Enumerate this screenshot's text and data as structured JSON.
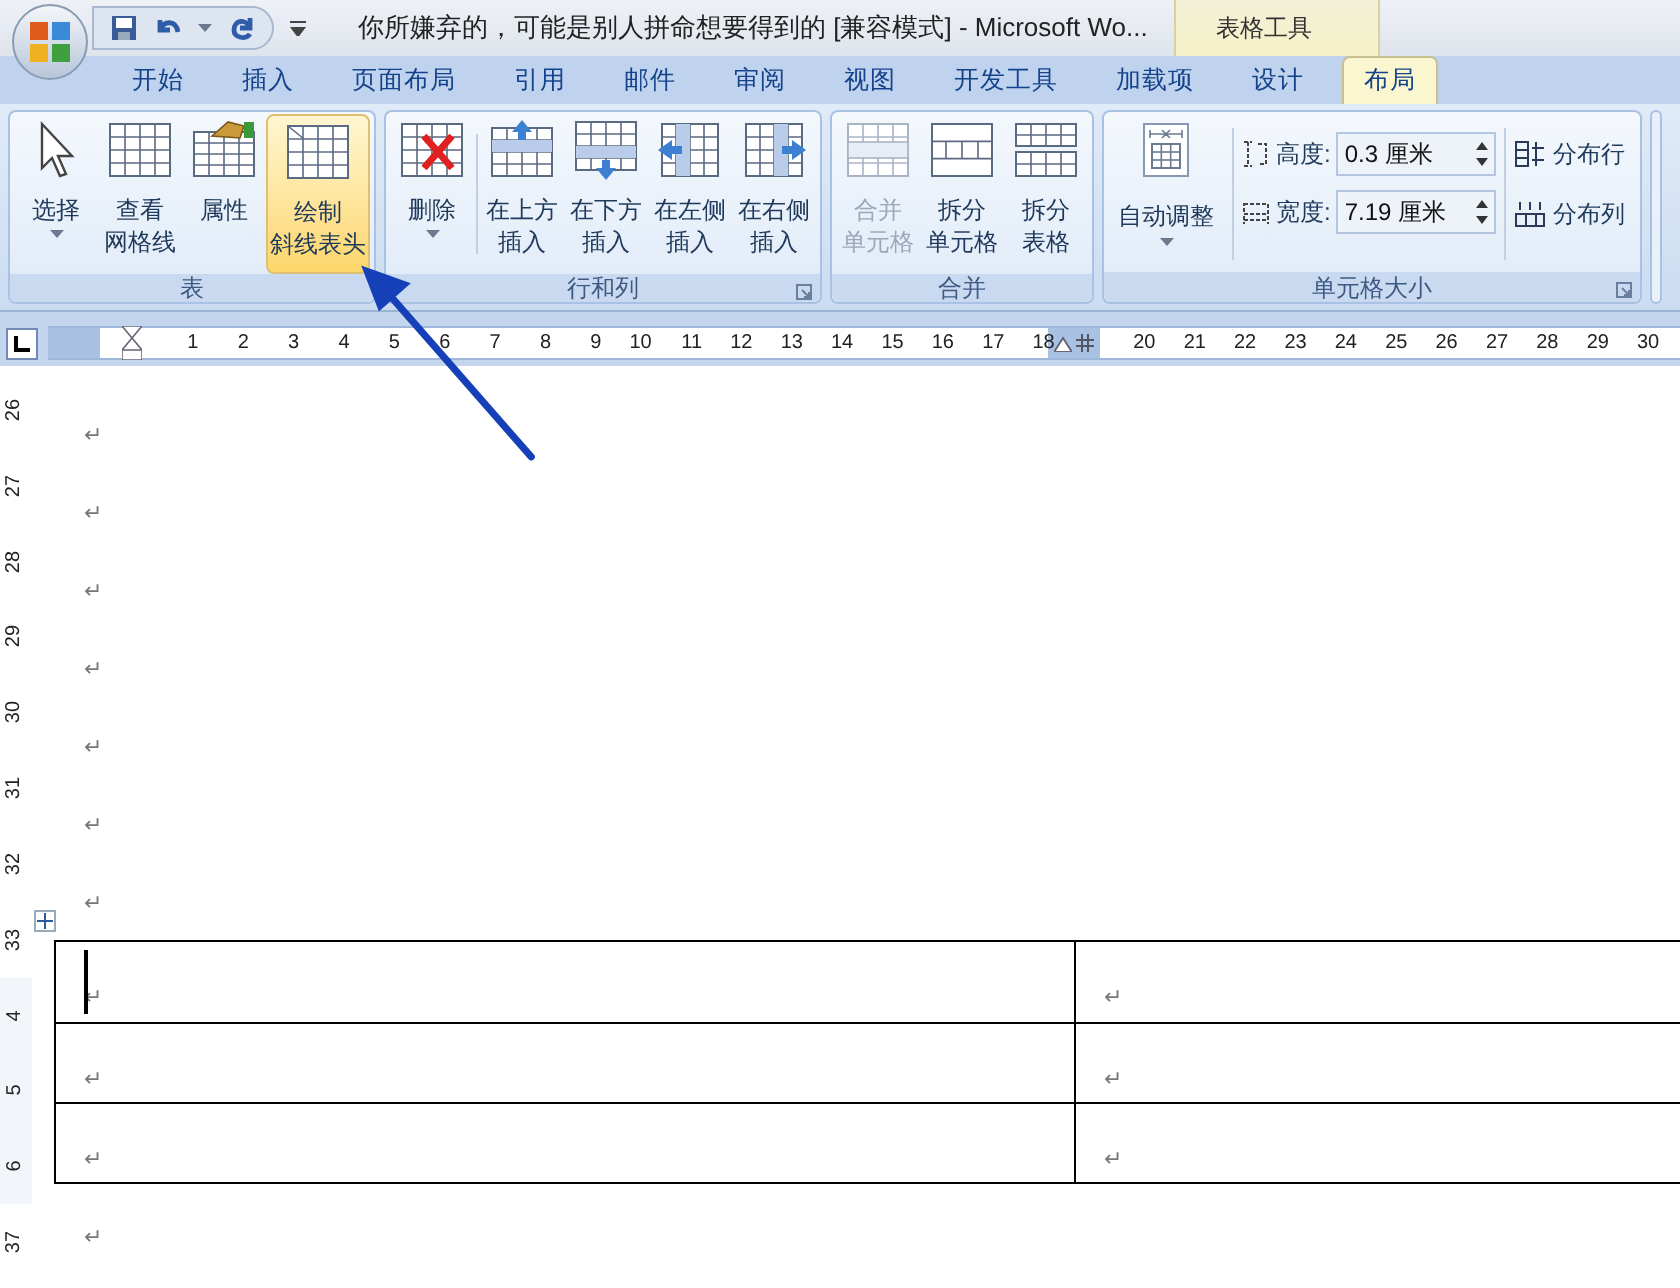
{
  "window": {
    "title": "你所嫌弃的，可能是别人拼命想要得到的 [兼容模式] - Microsoft Wo...",
    "contextual_label": "表格工具"
  },
  "tabs": [
    {
      "label": "开始",
      "selected": false
    },
    {
      "label": "插入",
      "selected": false
    },
    {
      "label": "页面布局",
      "selected": false
    },
    {
      "label": "引用",
      "selected": false
    },
    {
      "label": "邮件",
      "selected": false
    },
    {
      "label": "审阅",
      "selected": false
    },
    {
      "label": "视图",
      "selected": false
    },
    {
      "label": "开发工具",
      "selected": false
    },
    {
      "label": "加载项",
      "selected": false
    },
    {
      "label": "设计",
      "selected": false
    },
    {
      "label": "布局",
      "selected": true
    }
  ],
  "ribbon_groups": [
    {
      "label": "表",
      "buttons": [
        {
          "kind": "select",
          "lines": [
            "选择"
          ],
          "dropdown": true,
          "highlighted": false,
          "disabled": false
        },
        {
          "kind": "gridlines",
          "lines": [
            "查看",
            "网格线"
          ],
          "dropdown": false,
          "highlighted": false,
          "disabled": false
        },
        {
          "kind": "properties",
          "lines": [
            "属性"
          ],
          "dropdown": false,
          "highlighted": false,
          "disabled": false
        },
        {
          "kind": "diagonal",
          "lines": [
            "绘制",
            "斜线表头"
          ],
          "dropdown": false,
          "highlighted": true,
          "disabled": false
        }
      ]
    },
    {
      "label": "行和列",
      "buttons": [
        {
          "kind": "delete",
          "lines": [
            "删除"
          ],
          "dropdown": true,
          "highlighted": false,
          "disabled": false
        },
        {
          "kind": "insert-above",
          "lines": [
            "在上方",
            "插入"
          ],
          "dropdown": false,
          "highlighted": false,
          "disabled": false
        },
        {
          "kind": "insert-below",
          "lines": [
            "在下方",
            "插入"
          ],
          "dropdown": false,
          "highlighted": false,
          "disabled": false
        },
        {
          "kind": "insert-left",
          "lines": [
            "在左侧",
            "插入"
          ],
          "dropdown": false,
          "highlighted": false,
          "disabled": false
        },
        {
          "kind": "insert-right",
          "lines": [
            "在右侧",
            "插入"
          ],
          "dropdown": false,
          "highlighted": false,
          "disabled": false
        }
      ]
    },
    {
      "label": "合并",
      "buttons": [
        {
          "kind": "merge",
          "lines": [
            "合并",
            "单元格"
          ],
          "dropdown": false,
          "highlighted": false,
          "disabled": true
        },
        {
          "kind": "split-cells",
          "lines": [
            "拆分",
            "单元格"
          ],
          "dropdown": false,
          "highlighted": false,
          "disabled": false
        },
        {
          "kind": "split-table",
          "lines": [
            "拆分",
            "表格"
          ],
          "dropdown": false,
          "highlighted": false,
          "disabled": false
        }
      ]
    }
  ],
  "cell_size": {
    "label": "单元格大小",
    "autofit": {
      "label": "自动调整",
      "dropdown": true
    },
    "height": {
      "label": "高度:",
      "value": "0.3 厘米"
    },
    "width": {
      "label": "宽度:",
      "value": "7.19 厘米"
    },
    "distribute_rows": "分布行",
    "distribute_columns": "分布列"
  },
  "ruler": {
    "items": [
      {
        "kind": "number",
        "label": "1"
      },
      {
        "kind": "number",
        "label": "2"
      },
      {
        "kind": "number",
        "label": "3"
      },
      {
        "kind": "number",
        "label": "4"
      },
      {
        "kind": "number",
        "label": "5"
      },
      {
        "kind": "number",
        "label": "6"
      },
      {
        "kind": "number",
        "label": "7"
      },
      {
        "kind": "number",
        "label": "8"
      },
      {
        "kind": "number",
        "label": "9"
      },
      {
        "kind": "number",
        "label": "10"
      },
      {
        "kind": "number",
        "label": "11"
      },
      {
        "kind": "number",
        "label": "12"
      },
      {
        "kind": "number",
        "label": "13"
      },
      {
        "kind": "number",
        "label": "14"
      },
      {
        "kind": "number",
        "label": "15"
      },
      {
        "kind": "number",
        "label": "16"
      },
      {
        "kind": "number",
        "label": "17"
      },
      {
        "kind": "number",
        "label": "18"
      },
      {
        "kind": "marker"
      },
      {
        "kind": "number",
        "label": "20"
      },
      {
        "kind": "number",
        "label": "21"
      },
      {
        "kind": "number",
        "label": "22"
      },
      {
        "kind": "number",
        "label": "23"
      },
      {
        "kind": "number",
        "label": "24"
      },
      {
        "kind": "number",
        "label": "25"
      },
      {
        "kind": "number",
        "label": "26"
      },
      {
        "kind": "number",
        "label": "27"
      },
      {
        "kind": "number",
        "label": "28"
      },
      {
        "kind": "number",
        "label": "29"
      },
      {
        "kind": "number",
        "label": "30"
      }
    ],
    "vertical": [
      "26",
      "27",
      "28",
      "29",
      "30",
      "31",
      "32",
      "33",
      "4",
      "5",
      "6",
      "37"
    ]
  },
  "document": {
    "paragraphs_before": [
      "↵",
      "↵",
      "↵",
      "↵",
      "↵",
      "↵",
      "↵"
    ],
    "table": {
      "rows": [
        {
          "cells": [
            {
              "text": "↵",
              "cursor": true
            },
            {
              "text": "↵",
              "cursor": false
            }
          ]
        },
        {
          "cells": [
            {
              "text": "↵",
              "cursor": false
            },
            {
              "text": "↵",
              "cursor": false
            }
          ]
        },
        {
          "cells": [
            {
              "text": "↵",
              "cursor": false
            },
            {
              "text": "↵",
              "cursor": false
            }
          ]
        }
      ]
    },
    "paragraphs_after": [
      "↵"
    ]
  }
}
